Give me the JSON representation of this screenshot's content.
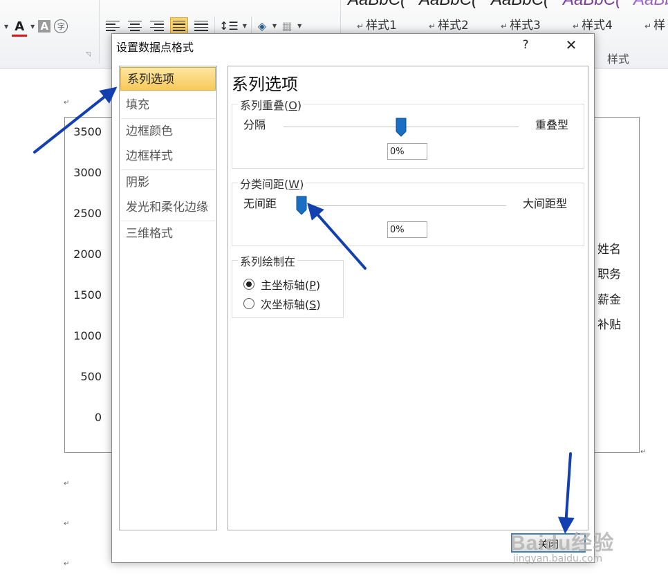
{
  "ribbon": {
    "font_color_label": "A",
    "highlight_label": "A",
    "enclosed_char_label": "字",
    "styles": [
      {
        "preview": "AaBbC(",
        "name": "样式1",
        "color": "#1a1a1a"
      },
      {
        "preview": "AaBbC(",
        "name": "样式2",
        "color": "#1a1a1a"
      },
      {
        "preview": "AaBbC(",
        "name": "样式3",
        "color": "#1a1a1a"
      },
      {
        "preview": "AaBbC(",
        "name": "样式4",
        "color": "#7a3f9a"
      },
      {
        "preview": "AaBb",
        "name": "样",
        "color": "#9b63c6"
      }
    ],
    "styles_group_label": "样式",
    "style_marker": "↵"
  },
  "document": {
    "paragraph_mark": "↵",
    "y_axis_ticks": [
      "3500",
      "3000",
      "2500",
      "2000",
      "1500",
      "1000",
      "500",
      "0"
    ],
    "legend": [
      "姓名",
      "职务",
      "薪金",
      "补贴"
    ]
  },
  "dialog": {
    "title": "设置数据点格式",
    "help": "?",
    "close_glyph": "✕",
    "nav_items": [
      "系列选项",
      "填充",
      "边框颜色",
      "边框样式",
      "阴影",
      "发光和柔化边缘",
      "三维格式"
    ],
    "selected_nav_index": 0,
    "panel_title": "系列选项",
    "overlap_group": {
      "title": "系列重叠",
      "access_key": "O",
      "left_label": "分隔",
      "right_label": "重叠型",
      "value": "0%"
    },
    "gap_group": {
      "title": "分类间距",
      "access_key": "W",
      "left_label": "无间距",
      "right_label": "大间距型",
      "value": "0%"
    },
    "plot_on_group": {
      "title": "系列绘制在",
      "options": [
        {
          "label": "主坐标轴",
          "access_key": "P",
          "selected": true
        },
        {
          "label": "次坐标轴",
          "access_key": "S",
          "selected": false
        }
      ]
    },
    "close_button": "关闭"
  },
  "watermark": {
    "text": "Baidu经验",
    "sub": "jingyan.baidu.com"
  },
  "colors": {
    "slider_thumb": "#1a6fc4",
    "annotation_arrow": "#1340b0",
    "selected_nav": "#f8c95a"
  }
}
